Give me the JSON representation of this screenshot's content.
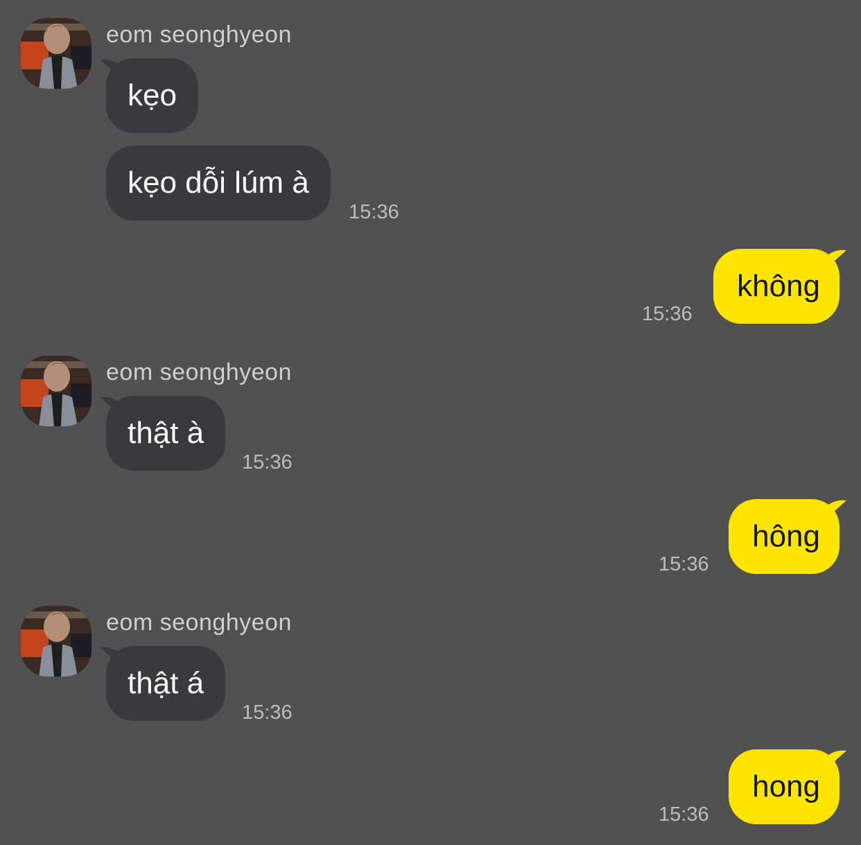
{
  "theme": {
    "background": "#525152",
    "incoming_bubble": "#3a3a3c",
    "outgoing_bubble": "#fee500"
  },
  "messages": [
    {
      "direction": "incoming",
      "sender": "eom seonghyeon",
      "text": "kẹo",
      "time": ""
    },
    {
      "direction": "incoming",
      "sender": "",
      "text": "kẹo dỗi lúm à",
      "time": "15:36"
    },
    {
      "direction": "outgoing",
      "text": "không",
      "time": "15:36"
    },
    {
      "direction": "incoming",
      "sender": "eom seonghyeon",
      "text": "thật à",
      "time": "15:36"
    },
    {
      "direction": "outgoing",
      "text": "hông",
      "time": "15:36"
    },
    {
      "direction": "incoming",
      "sender": "eom seonghyeon",
      "text": "thật á",
      "time": "15:36"
    },
    {
      "direction": "outgoing",
      "text": "hong",
      "time": "15:36"
    }
  ]
}
